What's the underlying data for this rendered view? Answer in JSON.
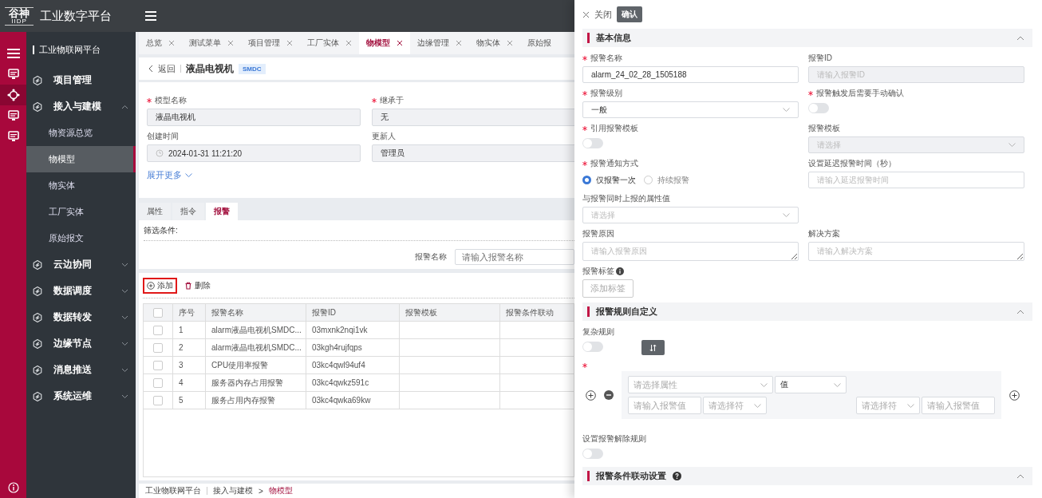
{
  "header": {
    "logo_top": "谷神",
    "logo_bottom": "IIDP",
    "title": "工业数字平台"
  },
  "rail": [
    {
      "kind": "menu",
      "selected": false
    },
    {
      "kind": "monitor",
      "selected": false
    },
    {
      "kind": "hub",
      "selected": true
    },
    {
      "kind": "monitor",
      "selected": false
    },
    {
      "kind": "monitor",
      "selected": false
    }
  ],
  "sidebar": {
    "title": "工业物联网平台",
    "items": [
      {
        "label": "项目管理"
      },
      {
        "label": "接入与建模",
        "expanded": true,
        "children": [
          {
            "label": "物资源总览",
            "selected": false
          },
          {
            "label": "物模型",
            "selected": true
          },
          {
            "label": "物实体",
            "selected": false
          },
          {
            "label": "工厂实体",
            "selected": false
          },
          {
            "label": "原始报文",
            "selected": false
          }
        ]
      },
      {
        "label": "云边协同",
        "expanded": false
      },
      {
        "label": "数据调度",
        "expanded": false
      },
      {
        "label": "数据转发",
        "expanded": false
      },
      {
        "label": "边缘节点",
        "expanded": false
      },
      {
        "label": "消息推送",
        "expanded": false
      },
      {
        "label": "系统运维",
        "expanded": false
      }
    ]
  },
  "tabs": [
    {
      "label": "总览",
      "selected": false
    },
    {
      "label": "测试菜单",
      "selected": false
    },
    {
      "label": "项目管理",
      "selected": false
    },
    {
      "label": "工厂实体",
      "selected": false
    },
    {
      "label": "物模型",
      "selected": true
    },
    {
      "label": "边缘管理",
      "selected": false
    },
    {
      "label": "物实体",
      "selected": false
    },
    {
      "label": "原始报",
      "selected": false
    }
  ],
  "page_header": {
    "back": "返回",
    "title": "液晶电视机",
    "badge": "SMDC"
  },
  "model_form": {
    "fields": [
      {
        "label": "模型名称",
        "required": true,
        "kind": "input",
        "value": "液晶电视机"
      },
      {
        "label": "继承于",
        "required": true,
        "kind": "select",
        "value": "无"
      },
      {
        "label": "创建时间",
        "required": false,
        "kind": "date",
        "value": "2024-01-31 11:21:20"
      },
      {
        "label": "更新人",
        "required": false,
        "kind": "select",
        "value": "管理员"
      }
    ],
    "expand_link": "展开更多"
  },
  "detail_tabs": [
    {
      "label": "属性",
      "selected": false
    },
    {
      "label": "指令",
      "selected": false
    },
    {
      "label": "报警",
      "selected": true
    }
  ],
  "filter": {
    "title": "筛选条件:",
    "label": "报警名称",
    "placeholder": "请输入报警名称"
  },
  "toolbar": {
    "add": "添加",
    "add_highlighted": true,
    "delete": "删除"
  },
  "table": {
    "columns": [
      "序号",
      "报警名称",
      "报警ID",
      "报警模板",
      "报警条件联动"
    ],
    "header_checked": false,
    "rows": [
      {
        "checked": false,
        "no": "1",
        "name": "alarm液晶电视机SMDC...",
        "alarm_id": "03mxnk2nqi1vk"
      },
      {
        "checked": false,
        "no": "2",
        "name": "alarm液晶电视机SMDC...",
        "alarm_id": "03kgh4rujfqps"
      },
      {
        "checked": false,
        "no": "3",
        "name": "CPU使用率报警",
        "alarm_id": "03kc4qwl94uf4"
      },
      {
        "checked": false,
        "no": "4",
        "name": "服务器内存占用报警",
        "alarm_id": "03kc4qwkz591c"
      },
      {
        "checked": false,
        "no": "5",
        "name": "服务占用内存报警",
        "alarm_id": "03kc4qwka69kw"
      }
    ]
  },
  "breadcrumb": {
    "root": "工业物联网平台",
    "parent": "接入与建模",
    "separator": ">",
    "current": "物模型"
  },
  "drawer": {
    "close": "关闭",
    "confirm": "确认",
    "basic": {
      "title": "基本信息",
      "expanded": true,
      "rows": [
        [
          {
            "kind": "input",
            "label": "报警名称",
            "required": true,
            "disabled": false,
            "value": "alarm_24_02_28_1505188"
          },
          {
            "kind": "input",
            "label": "报警ID",
            "required": false,
            "disabled": true,
            "placeholder": "请输入报警ID"
          }
        ],
        [
          {
            "kind": "select",
            "label": "报警级别",
            "required": true,
            "disabled": false,
            "value": "一般"
          },
          {
            "kind": "switch",
            "label": "报警触发后需要手动确认",
            "required": true,
            "on": false
          }
        ],
        [
          {
            "kind": "switch",
            "label": "引用报警模板",
            "required": true,
            "on": false
          },
          {
            "kind": "select",
            "label": "报警模板",
            "required": false,
            "disabled": true,
            "placeholder": "请选择"
          }
        ],
        [
          {
            "kind": "radio",
            "label": "报警通知方式",
            "required": true,
            "options": [
              {
                "label": "仅报警一次",
                "selected": true
              },
              {
                "label": "持续报警",
                "selected": false
              }
            ]
          },
          {
            "kind": "input",
            "label": "设置延迟报警时间（秒）",
            "required": false,
            "disabled": false,
            "placeholder": "请输入延迟报警时间"
          }
        ],
        [
          {
            "kind": "select",
            "label": "与报警同时上报的属性值",
            "required": false,
            "disabled": false,
            "placeholder": "请选择"
          }
        ],
        [
          {
            "kind": "textarea",
            "label": "报警原因",
            "required": false,
            "placeholder": "请输入报警原因"
          },
          {
            "kind": "textarea",
            "label": "解决方案",
            "required": false,
            "placeholder": "请输入解决方案"
          }
        ],
        [
          {
            "kind": "tags",
            "label": "报警标签",
            "required": false,
            "add": "添加标签"
          }
        ]
      ]
    },
    "rules": {
      "title": "报警规则自定义",
      "expanded": true,
      "complex_label": "复杂规则",
      "complex_on": false,
      "condition_required": true,
      "attribute_placeholder": "请选择属性",
      "value_type": "值",
      "left_value_placeholder": "请输入报警值",
      "left_operator_placeholder": "请选择符",
      "right_operator_placeholder": "请选择符",
      "right_value_placeholder": "请输入报警值",
      "release_label": "设置报警解除规则",
      "release_on": false
    },
    "linkage": {
      "title": "报警条件联动设置",
      "expanded": true
    }
  }
}
